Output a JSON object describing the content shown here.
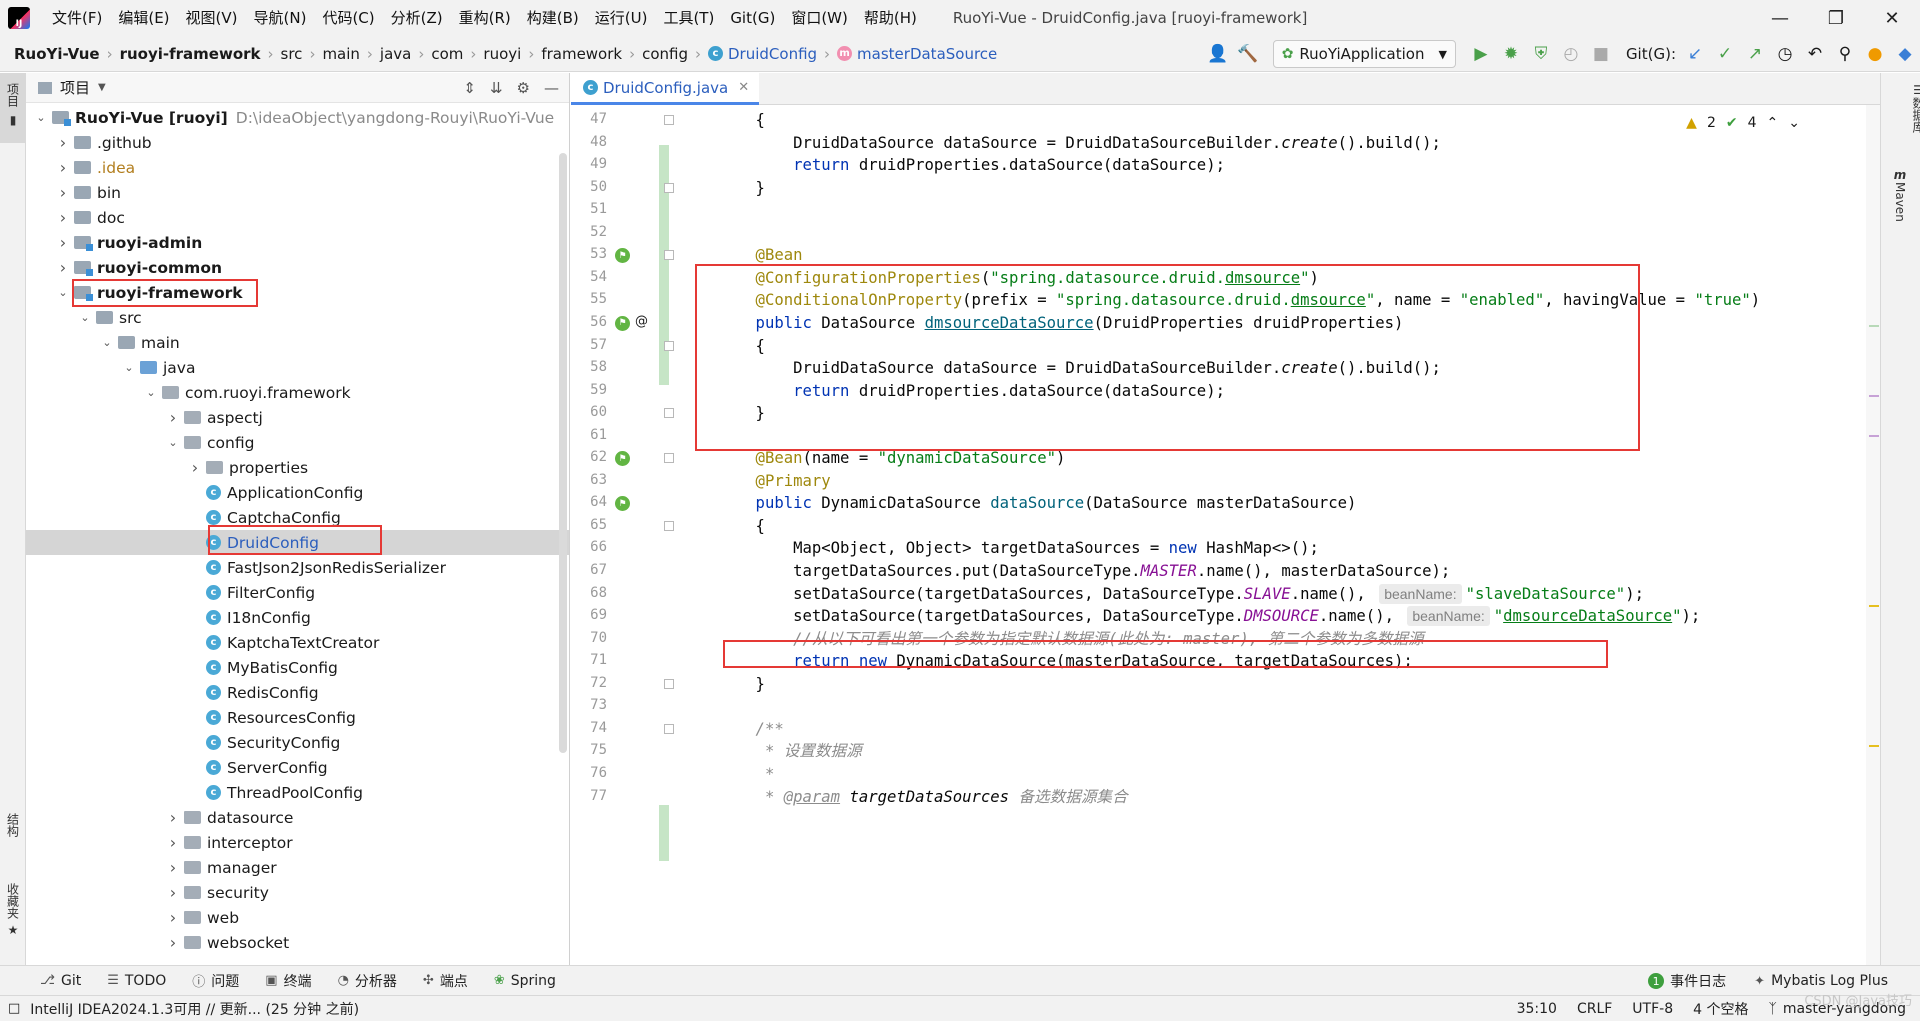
{
  "menubar": {
    "items": [
      "文件(F)",
      "编辑(E)",
      "视图(V)",
      "导航(N)",
      "代码(C)",
      "分析(Z)",
      "重构(R)",
      "构建(B)",
      "运行(U)",
      "工具(T)",
      "Git(G)",
      "窗口(W)",
      "帮助(H)"
    ],
    "window_title": "RuoYi-Vue - DruidConfig.java [ruoyi-framework]"
  },
  "breadcrumb": {
    "items": [
      "RuoYi-Vue",
      "ruoyi-framework",
      "src",
      "main",
      "java",
      "com",
      "ruoyi",
      "framework",
      "config",
      "DruidConfig",
      "masterDataSource"
    ]
  },
  "toolbar": {
    "run_config": "RuoYiApplication",
    "git_label": "Git(G):"
  },
  "project_panel": {
    "title": "项目",
    "tree": [
      {
        "label": "RuoYi-Vue [ruoyi]",
        "path": "D:\\ideaObject\\yangdong-Rouyi\\RuoYi-Vue",
        "depth": 0,
        "expanded": true,
        "type": "module"
      },
      {
        "label": ".github",
        "depth": 1,
        "expanded": false,
        "type": "folder"
      },
      {
        "label": ".idea",
        "depth": 1,
        "expanded": false,
        "type": "folder"
      },
      {
        "label": "bin",
        "depth": 1,
        "expanded": false,
        "type": "folder"
      },
      {
        "label": "doc",
        "depth": 1,
        "expanded": false,
        "type": "folder"
      },
      {
        "label": "ruoyi-admin",
        "depth": 1,
        "expanded": false,
        "type": "module"
      },
      {
        "label": "ruoyi-common",
        "depth": 1,
        "expanded": false,
        "type": "module"
      },
      {
        "label": "ruoyi-framework",
        "depth": 1,
        "expanded": true,
        "type": "module"
      },
      {
        "label": "src",
        "depth": 2,
        "expanded": true,
        "type": "folder"
      },
      {
        "label": "main",
        "depth": 3,
        "expanded": true,
        "type": "folder"
      },
      {
        "label": "java",
        "depth": 4,
        "expanded": true,
        "type": "source"
      },
      {
        "label": "com.ruoyi.framework",
        "depth": 5,
        "expanded": true,
        "type": "package"
      },
      {
        "label": "aspectj",
        "depth": 6,
        "expanded": false,
        "type": "package"
      },
      {
        "label": "config",
        "depth": 6,
        "expanded": true,
        "type": "package"
      },
      {
        "label": "properties",
        "depth": 7,
        "expanded": false,
        "type": "package"
      },
      {
        "label": "ApplicationConfig",
        "depth": 7,
        "type": "class"
      },
      {
        "label": "CaptchaConfig",
        "depth": 7,
        "type": "class"
      },
      {
        "label": "DruidConfig",
        "depth": 7,
        "type": "class"
      },
      {
        "label": "FastJson2JsonRedisSerializer",
        "depth": 7,
        "type": "class"
      },
      {
        "label": "FilterConfig",
        "depth": 7,
        "type": "class"
      },
      {
        "label": "I18nConfig",
        "depth": 7,
        "type": "class"
      },
      {
        "label": "KaptchaTextCreator",
        "depth": 7,
        "type": "class"
      },
      {
        "label": "MyBatisConfig",
        "depth": 7,
        "type": "class"
      },
      {
        "label": "RedisConfig",
        "depth": 7,
        "type": "class"
      },
      {
        "label": "ResourcesConfig",
        "depth": 7,
        "type": "class"
      },
      {
        "label": "SecurityConfig",
        "depth": 7,
        "type": "class"
      },
      {
        "label": "ServerConfig",
        "depth": 7,
        "type": "class"
      },
      {
        "label": "ThreadPoolConfig",
        "depth": 7,
        "type": "class"
      },
      {
        "label": "datasource",
        "depth": 6,
        "expanded": false,
        "type": "package"
      },
      {
        "label": "interceptor",
        "depth": 6,
        "expanded": false,
        "type": "package"
      },
      {
        "label": "manager",
        "depth": 6,
        "expanded": false,
        "type": "package"
      },
      {
        "label": "security",
        "depth": 6,
        "expanded": false,
        "type": "package"
      },
      {
        "label": "web",
        "depth": 6,
        "expanded": false,
        "type": "package"
      },
      {
        "label": "websocket",
        "depth": 6,
        "expanded": false,
        "type": "package"
      }
    ]
  },
  "editor": {
    "tab_label": "DruidConfig.java",
    "inspection": {
      "warnings": "2",
      "checks": "4"
    },
    "lines": [
      {
        "no": "47",
        "tokens": [
          [
            "",
            "    {"
          ]
        ]
      },
      {
        "no": "48",
        "tokens": [
          [
            "",
            "        DruidDataSource dataSource = DruidDataSourceBuilder."
          ],
          [
            "it",
            "create"
          ],
          [
            "",
            "().build();"
          ]
        ]
      },
      {
        "no": "49",
        "tokens": [
          [
            "kw",
            "        return "
          ],
          [
            "",
            "druidProperties.dataSource(dataSource);"
          ]
        ]
      },
      {
        "no": "50",
        "tokens": [
          [
            "",
            "    }"
          ]
        ]
      },
      {
        "no": "51",
        "tokens": []
      },
      {
        "no": "52",
        "tokens": []
      },
      {
        "no": "53",
        "tokens": [
          [
            "ann",
            "    @Bean"
          ]
        ]
      },
      {
        "no": "54",
        "tokens": [
          [
            "ann",
            "    @ConfigurationProperties"
          ],
          [
            "",
            "("
          ],
          [
            "str",
            "\"spring.datasource.druid."
          ],
          [
            "str ul",
            "dmsource"
          ],
          [
            "str",
            "\""
          ],
          [
            "",
            ")"
          ]
        ]
      },
      {
        "no": "55",
        "tokens": [
          [
            "ann",
            "    @ConditionalOnProperty"
          ],
          [
            "",
            "(prefix = "
          ],
          [
            "str",
            "\"spring.datasource.druid."
          ],
          [
            "str ul",
            "dmsource"
          ],
          [
            "str",
            "\""
          ],
          [
            "",
            ", name = "
          ],
          [
            "str",
            "\"enabled\""
          ],
          [
            "",
            ", havingValue = "
          ],
          [
            "str",
            "\"true\""
          ],
          [
            "",
            ")"
          ]
        ]
      },
      {
        "no": "56",
        "tokens": [
          [
            "kw",
            "    public "
          ],
          [
            "",
            "DataSource "
          ],
          [
            "fn ul",
            "dmsourceDataSource"
          ],
          [
            "",
            "(DruidProperties druidProperties)"
          ]
        ]
      },
      {
        "no": "57",
        "tokens": [
          [
            "",
            "    {"
          ]
        ]
      },
      {
        "no": "58",
        "tokens": [
          [
            "",
            "        DruidDataSource dataSource = DruidDataSourceBuilder."
          ],
          [
            "it",
            "create"
          ],
          [
            "",
            "().build();"
          ]
        ]
      },
      {
        "no": "59",
        "tokens": [
          [
            "kw",
            "        return "
          ],
          [
            "",
            "druidProperties.dataSource(dataSource);"
          ]
        ]
      },
      {
        "no": "60",
        "tokens": [
          [
            "",
            "    }"
          ]
        ]
      },
      {
        "no": "61",
        "tokens": []
      },
      {
        "no": "62",
        "tokens": [
          [
            "ann",
            "    @Bean"
          ],
          [
            "",
            "(name = "
          ],
          [
            "str",
            "\"dynamicDataSource\""
          ],
          [
            "",
            ")"
          ]
        ]
      },
      {
        "no": "63",
        "tokens": [
          [
            "ann",
            "    @Primary"
          ]
        ]
      },
      {
        "no": "64",
        "tokens": [
          [
            "kw",
            "    public "
          ],
          [
            "",
            "DynamicDataSource "
          ],
          [
            "fn",
            "dataSource"
          ],
          [
            "",
            "(DataSource masterDataSource)"
          ]
        ]
      },
      {
        "no": "65",
        "tokens": [
          [
            "",
            "    {"
          ]
        ]
      },
      {
        "no": "66",
        "tokens": [
          [
            "",
            "        Map<Object, Object> targetDataSources = "
          ],
          [
            "kw",
            "new "
          ],
          [
            "",
            "HashMap<>();"
          ]
        ]
      },
      {
        "no": "67",
        "tokens": [
          [
            "",
            "        targetDataSources.put(DataSourceType."
          ],
          [
            "const",
            "MASTER"
          ],
          [
            "",
            ".name(), masterDataSource);"
          ]
        ]
      },
      {
        "no": "68",
        "tokens": [
          [
            "",
            "        setDataSource(targetDataSources, DataSourceType."
          ],
          [
            "const",
            "SLAVE"
          ],
          [
            "",
            ".name(), "
          ],
          [
            "hint",
            "beanName:"
          ],
          [
            "str",
            "\"slaveDataSource\""
          ],
          [
            "",
            ");"
          ]
        ]
      },
      {
        "no": "69",
        "tokens": [
          [
            "",
            "        setDataSource(targetDataSources, DataSourceType."
          ],
          [
            "const",
            "DMSOURCE"
          ],
          [
            "",
            ".name(), "
          ],
          [
            "hint",
            "beanName:"
          ],
          [
            "str",
            "\""
          ],
          [
            "str ul",
            "dmsourceDataSource"
          ],
          [
            "str",
            "\""
          ],
          [
            "",
            ");"
          ]
        ]
      },
      {
        "no": "70",
        "tokens": [
          [
            "cmt",
            "        //从以下可看出第一个参数为指定默认数据源(此处为: master), 第二个参数为多数据源"
          ]
        ]
      },
      {
        "no": "71",
        "tokens": [
          [
            "kw",
            "        return new "
          ],
          [
            "",
            "DynamicDataSource(masterDataSource, targetDataSources);"
          ]
        ]
      },
      {
        "no": "72",
        "tokens": [
          [
            "",
            "    }"
          ]
        ]
      },
      {
        "no": "73",
        "tokens": []
      },
      {
        "no": "74",
        "tokens": [
          [
            "cmt",
            "    /**"
          ]
        ]
      },
      {
        "no": "75",
        "tokens": [
          [
            "cmt",
            "     * 设置数据源"
          ]
        ]
      },
      {
        "no": "76",
        "tokens": [
          [
            "cmt",
            "     *"
          ]
        ]
      },
      {
        "no": "77",
        "tokens": [
          [
            "cmt",
            "     * "
          ],
          [
            "doc-tag",
            "@param"
          ],
          [
            "",
            " "
          ],
          [
            "it",
            "targetDataSources"
          ],
          [
            "cmt",
            " 备选数据源集合"
          ]
        ]
      }
    ]
  },
  "left_strip": {
    "project": "项目",
    "structure": "结构",
    "favorites": "收藏夹"
  },
  "right_strip": {
    "database": "数据库",
    "maven": "Maven"
  },
  "bottom_tools": {
    "items": [
      "Git",
      "TODO",
      "问题",
      "终端",
      "分析器",
      "端点",
      "Spring"
    ],
    "right": [
      "事件日志",
      "Mybatis Log Plus"
    ],
    "event_badge": "1"
  },
  "statusbar": {
    "message": "IntelliJ IDEA2024.1.3可用 // 更新... (25 分钟 之前)",
    "position": "35:10",
    "line_sep": "CRLF",
    "encoding": "UTF-8",
    "indent": "4 个空格",
    "branch": "master-yangdong",
    "watermark": "CSDN @Java技巧"
  },
  "colors": {
    "accent": "#4a86e8",
    "highlight_box": "#e53935"
  }
}
